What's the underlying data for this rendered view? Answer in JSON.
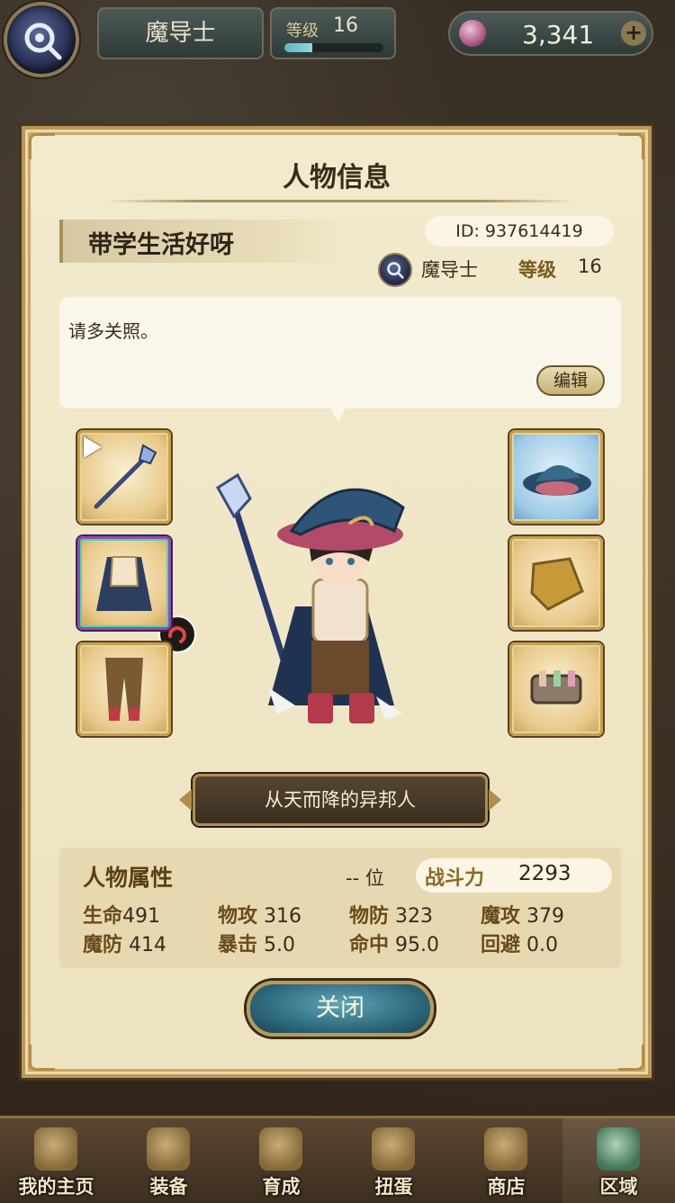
{
  "topbar": {
    "class_name": "魔导士",
    "level_label": "等级",
    "level_value": "16",
    "level_progress": 0.28,
    "currency_value": "3,341",
    "plus_label": "+"
  },
  "modal": {
    "title": "人物信息",
    "player_name": "带学生活好呀",
    "id_text": "ID: 937614419",
    "class_name": "魔导士",
    "level_label": "等级",
    "level_value": "16",
    "comment": "请多关照。",
    "edit_label": "编辑",
    "title_badge": "从天而降的异邦人",
    "close_label": "关闭"
  },
  "equipment": {
    "left": [
      "weapon-staff",
      "armor-coat",
      "pants"
    ],
    "right": [
      "wizard-hat",
      "gloves",
      "accessory-pouch"
    ]
  },
  "stats": {
    "heading": "人物属性",
    "rank_text": "-- 位",
    "power_label": "战斗力",
    "power_value": "2293",
    "items": [
      {
        "k": "生命",
        "v": "491"
      },
      {
        "k": "物攻",
        "v": "316"
      },
      {
        "k": "物防",
        "v": "323"
      },
      {
        "k": "魔攻",
        "v": "379"
      },
      {
        "k": "魔防",
        "v": "414"
      },
      {
        "k": "暴击",
        "v": "5.0"
      },
      {
        "k": "命中",
        "v": "95.0"
      },
      {
        "k": "回避",
        "v": "0.0"
      }
    ]
  },
  "nav": [
    {
      "label": "我的主页",
      "icon": "scroll-icon"
    },
    {
      "label": "装备",
      "icon": "helmet-icon"
    },
    {
      "label": "育成",
      "icon": "swords-icon"
    },
    {
      "label": "扭蛋",
      "icon": "gacha-icon"
    },
    {
      "label": "商店",
      "icon": "shop-icon"
    },
    {
      "label": "区域",
      "icon": "globe-icon"
    }
  ],
  "colors": {
    "panel": "#f2eacd",
    "gold_border": "#b9975a",
    "close_button": "#2e6a7e"
  }
}
